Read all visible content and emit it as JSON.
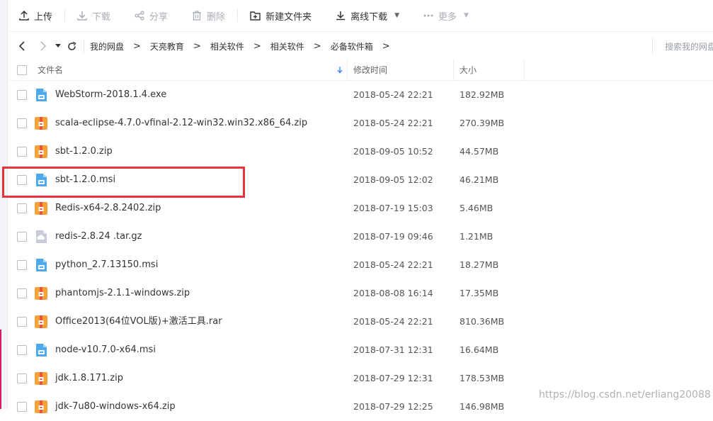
{
  "toolbar": {
    "upload": "上传",
    "download": "下载",
    "share": "分享",
    "delete": "删除",
    "new_folder": "新建文件夹",
    "offline_download": "离线下载",
    "more": "更多"
  },
  "breadcrumb": [
    "我的网盘",
    "天亮教育",
    "相关软件",
    "相关软件",
    "必备软件箱"
  ],
  "search": {
    "placeholder": "搜索我的网盘文件"
  },
  "table": {
    "headers": {
      "name": "文件名",
      "modified": "修改时间",
      "size": "大小"
    },
    "rows": [
      {
        "name": "WebStorm-2018.1.4.exe",
        "date": "2018-05-24 22:21",
        "size": "182.92MB",
        "icon": "installer-icon"
      },
      {
        "name": "scala-eclipse-4.7.0-vfinal-2.12-win32.win32.x86_64.zip",
        "date": "2018-05-24 22:21",
        "size": "270.39MB",
        "icon": "archive-icon"
      },
      {
        "name": "sbt-1.2.0.zip",
        "date": "2018-09-05 10:52",
        "size": "44.57MB",
        "icon": "archive-icon"
      },
      {
        "name": "sbt-1.2.0.msi",
        "date": "2018-09-05 12:02",
        "size": "46.21MB",
        "icon": "installer-icon"
      },
      {
        "name": "Redis-x64-2.8.2402.zip",
        "date": "2018-07-19 15:03",
        "size": "5.46MB",
        "icon": "archive-icon"
      },
      {
        "name": "redis-2.8.24 .tar.gz",
        "date": "2018-07-19 09:46",
        "size": "1.21MB",
        "icon": "unknown-file-icon"
      },
      {
        "name": "python_2.7.13150.msi",
        "date": "2018-05-24 22:21",
        "size": "18.27MB",
        "icon": "installer-icon"
      },
      {
        "name": "phantomjs-2.1.1-windows.zip",
        "date": "2018-08-08 16:14",
        "size": "17.35MB",
        "icon": "archive-icon"
      },
      {
        "name": "Office2013(64位VOL版)+激活工具.rar",
        "date": "2018-05-24 22:21",
        "size": "810.36MB",
        "icon": "archive-icon"
      },
      {
        "name": "node-v10.7.0-x64.msi",
        "date": "2018-07-31 12:31",
        "size": "16.64MB",
        "icon": "installer-icon"
      },
      {
        "name": "jdk.1.8.171.zip",
        "date": "2018-07-29 12:31",
        "size": "178.53MB",
        "icon": "archive-icon"
      },
      {
        "name": "jdk-7u80-windows-x64.zip",
        "date": "2018-07-29 12:25",
        "size": "146.98MB",
        "icon": "archive-icon"
      }
    ]
  },
  "watermark": "https://blog.csdn.net/erliang20088",
  "colors": {
    "archive": "#f6a23a",
    "installer": "#4ca9ec",
    "unknown": "#c5ccd6",
    "highlight": "#e8333a",
    "sort_arrow": "#3b8ee6"
  }
}
